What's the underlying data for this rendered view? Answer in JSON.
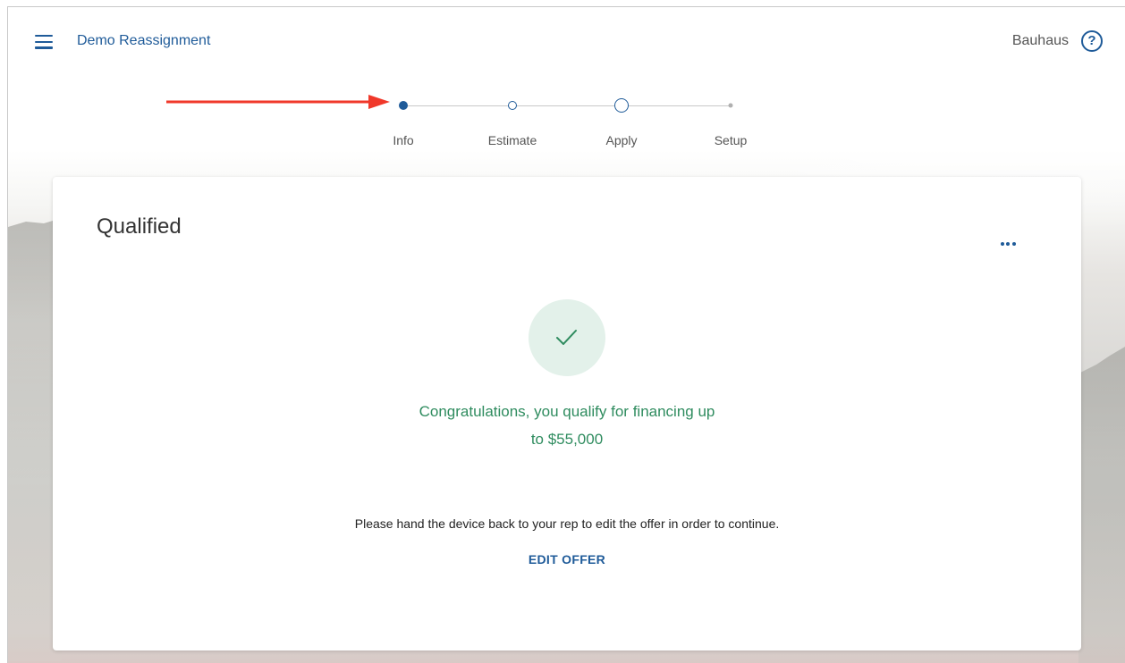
{
  "header": {
    "app_title": "Demo Reassignment",
    "org_name": "Bauhaus",
    "menu_icon": "hamburger-menu-icon",
    "help_icon": "help-circle-icon"
  },
  "annotation": {
    "arrow_color": "#f0382a"
  },
  "stepper": {
    "steps": [
      {
        "label": "Info",
        "state": "current"
      },
      {
        "label": "Estimate",
        "state": "upcoming"
      },
      {
        "label": "Apply",
        "state": "upcoming-large"
      },
      {
        "label": "Setup",
        "state": "inactive"
      }
    ]
  },
  "card": {
    "title": "Qualified",
    "more_icon": "more-horizontal-icon",
    "status_icon": "check-icon",
    "message_line1": "Congratulations, you qualify for financing up",
    "message_line2": "to $55,000",
    "instruction": "Please hand the device back to your rep to edit the offer in order to continue.",
    "edit_offer_label": "EDIT OFFER"
  },
  "colors": {
    "primary": "#1f5b99",
    "success": "#2f8c5f",
    "success_bg": "#e3f1ea"
  }
}
